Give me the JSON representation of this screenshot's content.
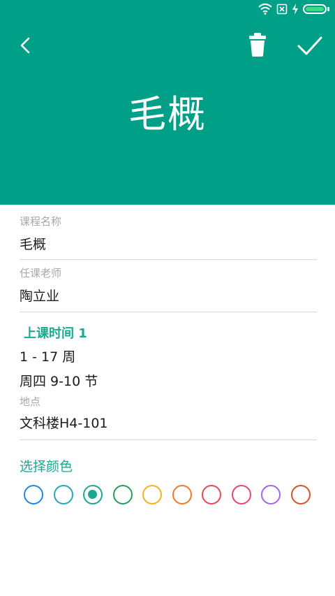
{
  "header": {
    "title": "毛概",
    "background": "#009f87",
    "back_icon": "chevron-left-icon",
    "delete_icon": "trash-icon",
    "confirm_icon": "checkmark-icon"
  },
  "status_bar": {
    "icons": [
      "wifi-icon",
      "no-sim-icon",
      "charging-icon",
      "battery-icon"
    ]
  },
  "form": {
    "course_name": {
      "label": "课程名称",
      "value": "毛概"
    },
    "teacher": {
      "label": "任课老师",
      "value": "陶立业"
    }
  },
  "schedule": {
    "title": "上课时间 1",
    "weeks": "1 - 17 周",
    "periods": "周四 9-10 节",
    "location": {
      "label": "地点",
      "value": "文科楼H4-101"
    }
  },
  "colors": {
    "title": "选择颜色",
    "selected_index": 2,
    "options": [
      {
        "name": "blue",
        "hex": "#1e88e5"
      },
      {
        "name": "cyan",
        "hex": "#26a6b8"
      },
      {
        "name": "teal",
        "hex": "#1aa88f"
      },
      {
        "name": "green",
        "hex": "#22a05a"
      },
      {
        "name": "amber",
        "hex": "#f5b324"
      },
      {
        "name": "orange",
        "hex": "#f07b27"
      },
      {
        "name": "red",
        "hex": "#ef4657"
      },
      {
        "name": "pink",
        "hex": "#e6437e"
      },
      {
        "name": "purple",
        "hex": "#a466e6"
      },
      {
        "name": "deep-orange",
        "hex": "#d6532a"
      }
    ]
  }
}
